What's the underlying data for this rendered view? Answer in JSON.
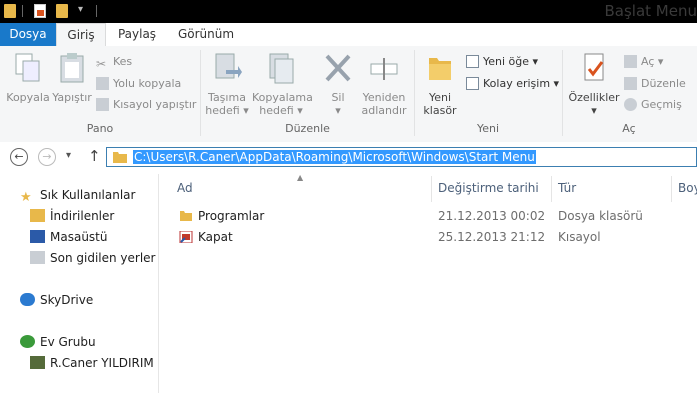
{
  "window": {
    "title": "Başlat Menu"
  },
  "ribbon_tabs": [
    "Dosya",
    "Giriş",
    "Paylaş",
    "Görünüm"
  ],
  "groups": {
    "pano": {
      "label": "Pano",
      "kopyala": "Kopyala",
      "yapistir": "Yapıştır",
      "kes": "Kes",
      "yolu_kopyala": "Yolu kopyala",
      "kisayol_yapistir": "Kısayol yapıştır"
    },
    "duzenle": {
      "label": "Düzenle",
      "tasima_hedefi": [
        "Taşıma",
        "hedefi ▾"
      ],
      "kopyalama_hedefi": [
        "Kopyalama",
        "hedefi ▾"
      ],
      "sil": [
        "Sil",
        "▾"
      ],
      "yeniden_adlandir": [
        "Yeniden",
        "adlandır"
      ]
    },
    "yeni": {
      "label": "Yeni",
      "yeni_klasor": [
        "Yeni",
        "klasör"
      ],
      "yeni_oge": "Yeni öğe ▾",
      "kolay_erisim": "Kolay erişim ▾"
    },
    "ac": {
      "label": "Aç",
      "ozellikler": [
        "Özellikler",
        "▾"
      ],
      "ac": "Aç ▾",
      "duzenle": "Düzenle",
      "gecmis": "Geçmiş"
    }
  },
  "address": {
    "path": "C:\\Users\\R.Caner\\AppData\\Roaming\\Microsoft\\Windows\\Start Menu"
  },
  "nav": {
    "favorites": "Sık Kullanılanlar",
    "indirilenler": "İndirilenler",
    "masaustu": "Masaüstü",
    "son_gidilen": "Son gidilen yerler",
    "skydrive": "SkyDrive",
    "ev_grubu": "Ev Grubu",
    "user": "R.Caner YILDIRIM"
  },
  "columns": {
    "name": "Ad",
    "date": "Değiştirme tarihi",
    "type": "Tür",
    "size": "Boy"
  },
  "files": [
    {
      "name": "Programlar",
      "date": "21.12.2013 00:02",
      "type": "Dosya klasörü"
    },
    {
      "name": "Kapat",
      "date": "25.12.2013 21:12",
      "type": "Kısayol"
    }
  ],
  "colors": {
    "accent": "#1979ca",
    "selection": "#3399ff",
    "folder": "#e8b84a"
  }
}
